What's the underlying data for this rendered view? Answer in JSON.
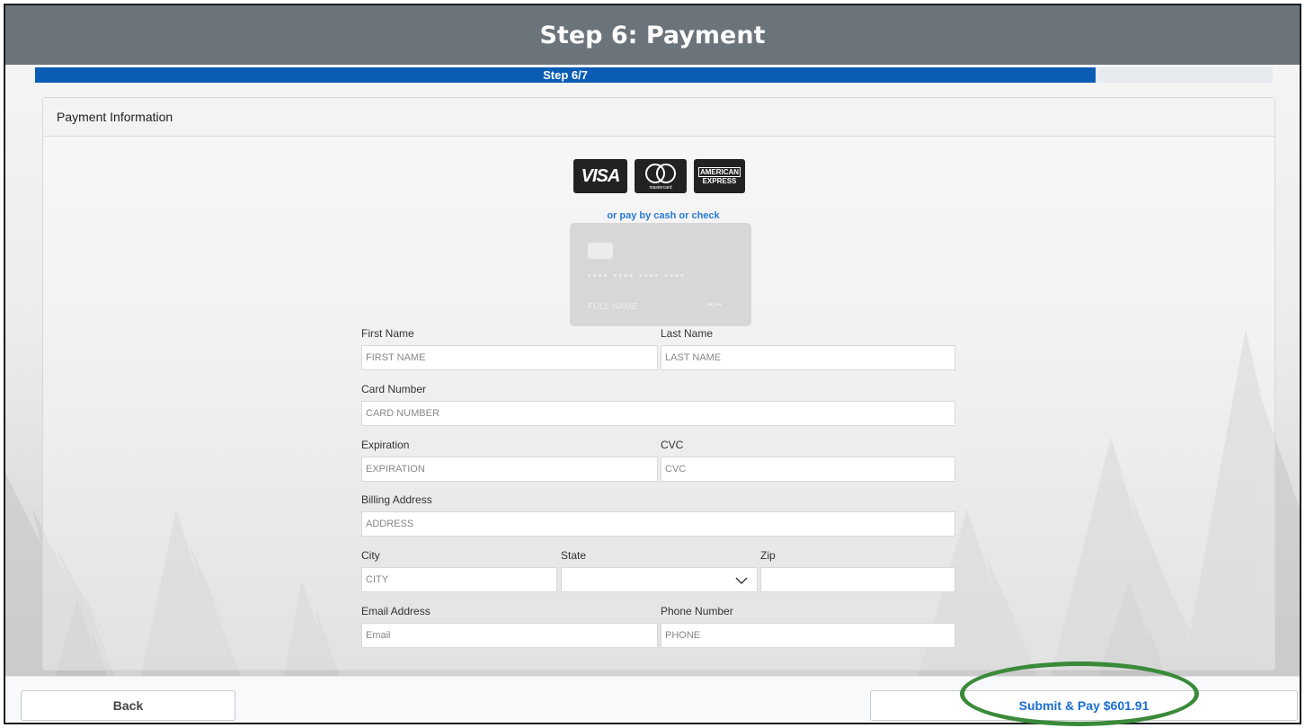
{
  "header": {
    "title": "Step 6: Payment"
  },
  "progress": {
    "label": "Step 6/7",
    "fraction": 0.857
  },
  "panel": {
    "title": "Payment Information"
  },
  "card_logos": {
    "visa": "VISA",
    "mastercard": "mastercard",
    "amex_line1": "AMERICAN",
    "amex_line2": "EXPRESS"
  },
  "cash_link": "or pay by cash or check",
  "card_preview": {
    "digits": "•••• •••• •••• ••••",
    "name": "FULL NAME",
    "expiry": "••/••"
  },
  "form": {
    "first_name": {
      "label": "First Name",
      "placeholder": "FIRST NAME"
    },
    "last_name": {
      "label": "Last Name",
      "placeholder": "LAST NAME"
    },
    "card_number": {
      "label": "Card Number",
      "placeholder": "CARD NUMBER"
    },
    "expiration": {
      "label": "Expiration",
      "placeholder": "EXPIRATION"
    },
    "cvc": {
      "label": "CVC",
      "placeholder": "CVC"
    },
    "billing_address": {
      "label": "Billing Address",
      "placeholder": "ADDRESS"
    },
    "city": {
      "label": "City",
      "placeholder": "CITY"
    },
    "state": {
      "label": "State",
      "value": ""
    },
    "zip": {
      "label": "Zip",
      "placeholder": ""
    },
    "email": {
      "label": "Email Address",
      "placeholder": "Email"
    },
    "phone": {
      "label": "Phone Number",
      "placeholder": "PHONE"
    }
  },
  "footer": {
    "back_label": "Back",
    "submit_label": "Submit & Pay $601.91"
  },
  "colors": {
    "header_bg": "#6b737b",
    "progress": "#0a5cb5",
    "link": "#2a7ad6",
    "highlight": "#3a8a3a"
  }
}
